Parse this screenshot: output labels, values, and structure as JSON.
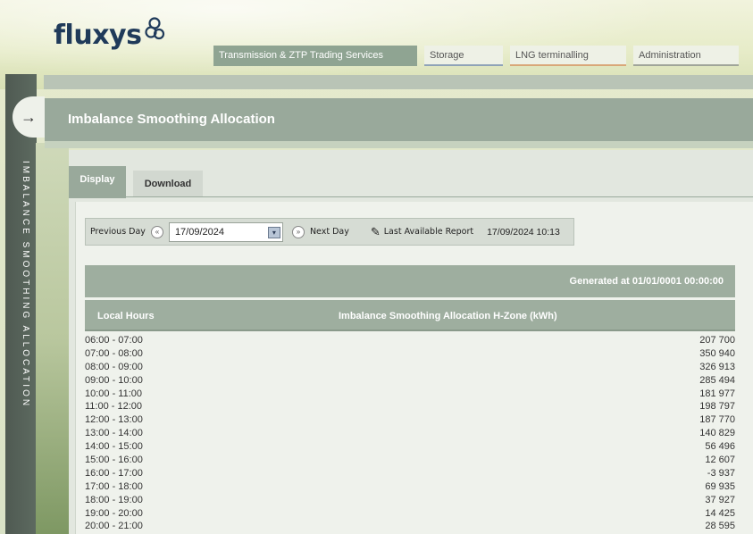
{
  "brand": {
    "logo_text": "fluxys"
  },
  "nav": {
    "items": [
      {
        "label": "Transmission & ZTP Trading Services",
        "active": true
      },
      {
        "label": "Storage"
      },
      {
        "label": "LNG terminalling"
      },
      {
        "label": "Administration"
      }
    ]
  },
  "sidebar": {
    "vertical_label": "IMBALANCE SMOOTHING ALLOCATION",
    "arrow": "→"
  },
  "page": {
    "title": "Imbalance Smoothing Allocation"
  },
  "tabs": [
    {
      "label": "Display"
    },
    {
      "label": "Download"
    }
  ],
  "toolbar": {
    "previous_day_label": "Previous Day",
    "date_value": "17/09/2024",
    "next_day_label": "Next Day",
    "last_report_label": "Last Available Report",
    "last_report_value": "17/09/2024 10:13"
  },
  "table": {
    "generated_at": "Generated at 01/01/0001 00:00:00",
    "col_hours": "Local Hours",
    "col_value": "Imbalance Smoothing Allocation H-Zone (kWh)",
    "rows": [
      {
        "hours": "06:00 - 07:00",
        "value": "207 700"
      },
      {
        "hours": "07:00 - 08:00",
        "value": "350 940"
      },
      {
        "hours": "08:00 - 09:00",
        "value": "326 913"
      },
      {
        "hours": "09:00 - 10:00",
        "value": "285 494"
      },
      {
        "hours": "10:00 - 11:00",
        "value": "181 977"
      },
      {
        "hours": "11:00 - 12:00",
        "value": "198 797"
      },
      {
        "hours": "12:00 - 13:00",
        "value": "187 770"
      },
      {
        "hours": "13:00 - 14:00",
        "value": "140 829"
      },
      {
        "hours": "14:00 - 15:00",
        "value": "56 496"
      },
      {
        "hours": "15:00 - 16:00",
        "value": "12 607"
      },
      {
        "hours": "16:00 - 17:00",
        "value": "-3 937"
      },
      {
        "hours": "17:00 - 18:00",
        "value": "69 935"
      },
      {
        "hours": "18:00 - 19:00",
        "value": "37 927"
      },
      {
        "hours": "19:00 - 20:00",
        "value": "14 425"
      },
      {
        "hours": "20:00 - 21:00",
        "value": "28 595"
      }
    ]
  },
  "colors": {
    "brand_navy": "#1f3a5a",
    "panel_green": "#99a99b"
  }
}
